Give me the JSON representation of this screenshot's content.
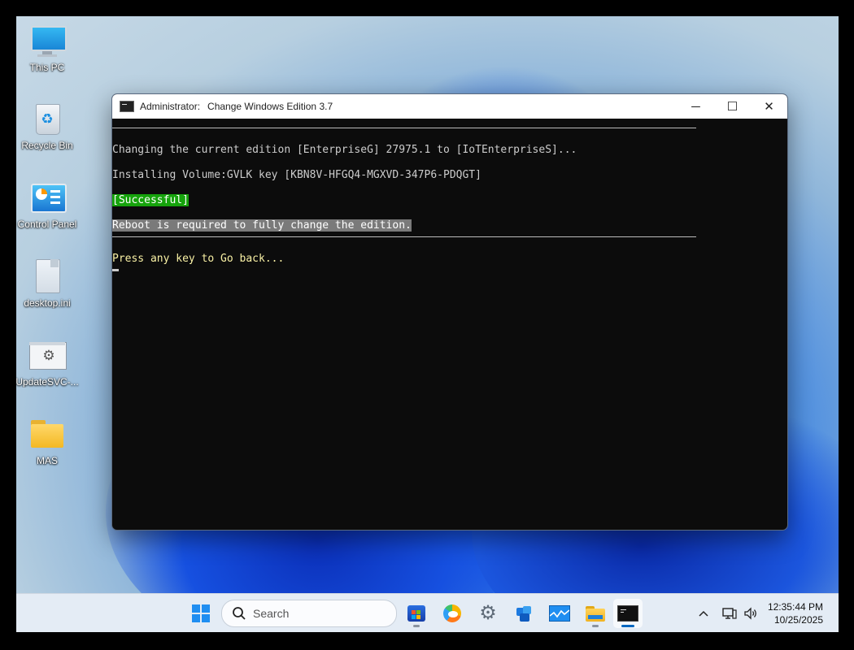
{
  "desktop": {
    "icons": [
      {
        "label": "This PC"
      },
      {
        "label": "Recycle Bin"
      },
      {
        "label": "Control Panel"
      },
      {
        "label": "desktop.ini"
      },
      {
        "label": "UpdateSVC-..."
      },
      {
        "label": "MAS"
      }
    ]
  },
  "window": {
    "title_prefix": "Administrator:",
    "title": "Change Windows Edition 3.7",
    "controls": {
      "minimize": "─",
      "maximize": "☐",
      "close": "✕"
    }
  },
  "console": {
    "line1": "Changing the current edition [EnterpriseG] 27975.1 to [IoTEnterpriseS]...",
    "line2": "Installing Volume:GVLK key [KBN8V-HFGQ4-MGXVD-347P6-PDQGT]",
    "line3": "[Successful]",
    "line4": "Reboot is required to fully change the edition.",
    "line5": "Press any key to Go back..."
  },
  "taskbar": {
    "search_placeholder": "Search",
    "clock_time": "12:35:44 PM",
    "clock_date": "10/25/2025"
  },
  "colors": {
    "console_bg": "#0c0c0c",
    "success_bg": "#16a30c",
    "highlight_bg": "#7a7a7a",
    "prompt_text": "#f9f1a5"
  }
}
